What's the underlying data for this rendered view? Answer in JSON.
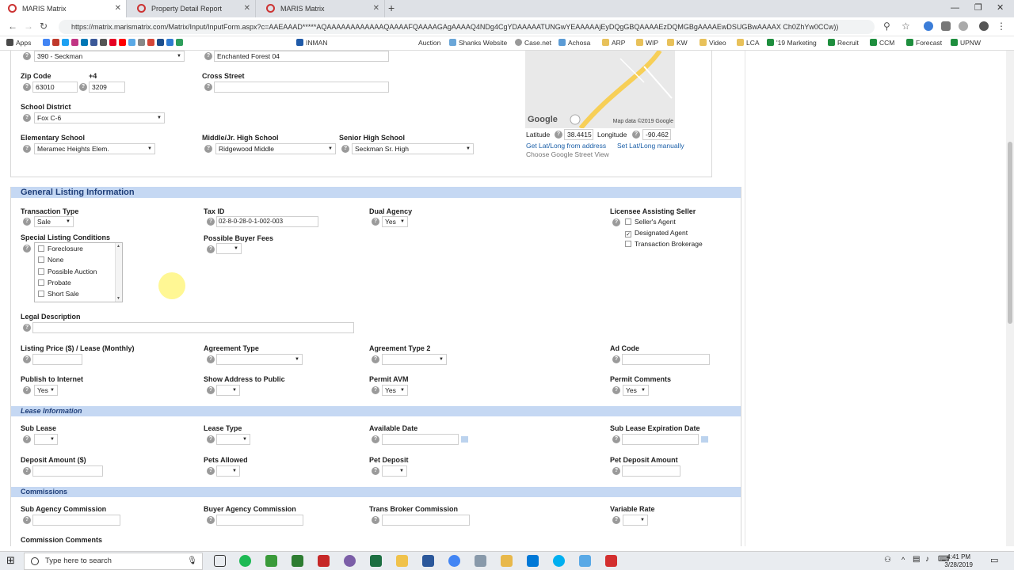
{
  "browser": {
    "tabs": [
      {
        "title": "MARIS Matrix",
        "active": true
      },
      {
        "title": "Property Detail Report",
        "active": false
      },
      {
        "title": "MARIS Matrix",
        "active": false
      }
    ],
    "url": "https://matrix.marismatrix.com/Matrix/Input/InputForm.aspx?c=AAEAAAD*****AQAAAAAAAAAAAAQAAAAFQAAAAGAgAAAAQ4NDg4CgYDAAAAATUNGwYEAAAAAjEyDQgGBQAAAAEzDQMGBgAAAAEwDSUGBwAAAAX Ch0ZhYw0CCw))",
    "bookmarks": [
      "Apps",
      "INMAN",
      "Auction",
      "Shanks Website",
      "Case.net",
      "Achosa",
      "ARP",
      "WIP",
      "KW",
      "Video",
      "LCA",
      "'19 Marketing",
      "Recruit",
      "CCM",
      "Forecast",
      "UPNW"
    ]
  },
  "location": {
    "area_value": "390 - Seckman",
    "subdivision_value": "Enchanted Forest 04",
    "zip_label": "Zip Code",
    "zip_value": "63010",
    "plus4_label": "+4",
    "plus4_value": "3209",
    "cross_street_label": "Cross Street",
    "school_district_label": "School District",
    "school_district_value": "Fox C-6",
    "elementary_label": "Elementary School",
    "elementary_value": "Meramec Heights Elem.",
    "middle_label": "Middle/Jr. High School",
    "middle_value": "Ridgewood Middle",
    "senior_label": "Senior High School",
    "senior_value": "Seckman Sr. High",
    "map_copyright": "Map data ©2019 Google",
    "map_logo": "Google",
    "latitude_label": "Latitude",
    "latitude_value": "38.4415",
    "longitude_label": "Longitude",
    "longitude_value": "-90.462",
    "link_from_address": "Get Lat/Long from address",
    "link_manual": "Set Lat/Long manually",
    "street_view": "Choose Google Street View"
  },
  "general": {
    "title": "General Listing Information",
    "transaction_type_label": "Transaction Type",
    "transaction_type_value": "Sale",
    "tax_id_label": "Tax ID",
    "tax_id_parts": [
      "02",
      "8",
      "0",
      "28",
      "0",
      "1",
      "002",
      "003"
    ],
    "dual_agency_label": "Dual Agency",
    "dual_agency_value": "Yes",
    "licensee_label": "Licensee Assisting Seller",
    "licensee_options": [
      {
        "label": "Seller's Agent",
        "checked": false
      },
      {
        "label": "Designated Agent",
        "checked": true
      },
      {
        "label": "Transaction Brokerage",
        "checked": false
      }
    ],
    "special_label": "Special Listing Conditions",
    "special_options": [
      "Foreclosure",
      "None",
      "Possible Auction",
      "Probate",
      "Short Sale"
    ],
    "buyer_fees_label": "Possible Buyer Fees",
    "legal_label": "Legal Description",
    "price_label": "Listing Price ($) / Lease (Monthly)",
    "agreement_label": "Agreement Type",
    "agreement2_label": "Agreement Type 2",
    "adcode_label": "Ad Code",
    "publish_label": "Publish to Internet",
    "publish_value": "Yes",
    "show_address_label": "Show Address to Public",
    "permit_avm_label": "Permit AVM",
    "permit_avm_value": "Yes",
    "permit_comments_label": "Permit Comments",
    "permit_comments_value": "Yes"
  },
  "lease": {
    "title": "Lease Information",
    "sub_lease_label": "Sub Lease",
    "lease_type_label": "Lease Type",
    "available_label": "Available Date",
    "sub_exp_label": "Sub Lease Expiration Date",
    "deposit_label": "Deposit Amount ($)",
    "pets_label": "Pets Allowed",
    "pet_deposit_label": "Pet Deposit",
    "pet_deposit_amount_label": "Pet Deposit Amount"
  },
  "commissions": {
    "title": "Commissions",
    "sub_agency_label": "Sub Agency Commission",
    "buyer_agency_label": "Buyer Agency Commission",
    "trans_broker_label": "Trans Broker Commission",
    "variable_rate_label": "Variable Rate",
    "comments_label": "Commission Comments"
  },
  "taskbar": {
    "search_placeholder": "Type here to search",
    "time": "4:41 PM",
    "date": "3/28/2019"
  },
  "colors": {
    "section_bg": "#c5d8f3",
    "section_text": "#1f3f7a",
    "link": "#1b5fa8"
  }
}
